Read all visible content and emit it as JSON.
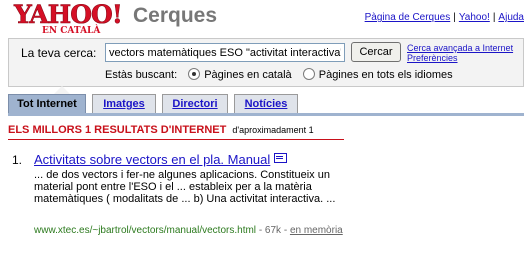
{
  "brand": {
    "logo_text": "YAHOO!",
    "logo_sub": "EN CATALÀ",
    "product": "Cerques",
    "colors": {
      "logo_red": "#d50f25",
      "link": "#1b14c7",
      "heading_red": "#c8101a",
      "url_green": "#2c7a1e"
    }
  },
  "top_links": {
    "cerques": "Pàgina de Cerques",
    "yahoo": "Yahoo!",
    "ajuda": "Ajuda",
    "separator": "|"
  },
  "search": {
    "label": "La teva cerca:",
    "value": "vectors matemàtiques ESO \"activitat interactiva\"",
    "button": "Cercar",
    "advanced_line1": "Cerca avançada a Internet",
    "advanced_line2": "Preferències",
    "lang_prompt": "Estàs buscant:",
    "lang_option_1": "Pàgines en català",
    "lang_option_2": "Pàgines en tots els idiomes",
    "lang_selected": "Pàgines en català"
  },
  "tabs": {
    "internet": "Tot Internet",
    "images": "Imatges",
    "directory": "Directori",
    "news": "Notícies",
    "active": "Tot Internet"
  },
  "results": {
    "heading": "ELS MILLORS 1 RESULTATS D'INTERNET",
    "approx": "d'aproximadament 1",
    "items": [
      {
        "number": "1.",
        "title": "Activitats sobre vectors en el pla. Manual",
        "icon": "document-icon",
        "snippet": "... de dos vectors i fer-ne algunes aplicacions. Constitueix un material pont entre l'ESO i el ... estableix per a la matèria matemàtiques ( modalitats de ... b) Una activitat interactiva. ...",
        "url": "www.xtec.es/~jbartrol/vectors/manual/vectors.html",
        "size": "67k",
        "cache": "en memòria"
      }
    ]
  }
}
